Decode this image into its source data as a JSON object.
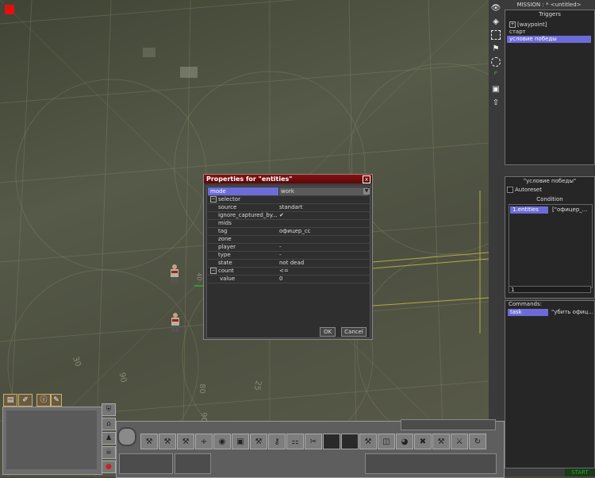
{
  "right_panel": {
    "mission_label": "MISSION : ",
    "mission_name": "* <untitled>",
    "triggers_title": "Triggers",
    "triggers": [
      {
        "label": "[waypoint]",
        "has_expander": true,
        "selected": false
      },
      {
        "label": "старт",
        "has_expander": false,
        "selected": false
      },
      {
        "label": "условие победы",
        "has_expander": false,
        "selected": true
      }
    ],
    "trigger_name": "\"условие победы\"",
    "autoreset_label": "Autoreset",
    "condition_title": "Condition",
    "condition_key": "1.entities",
    "condition_value": "[\"офицер_...",
    "condition_input": "1",
    "commands_title": "Commands:",
    "command_key": "task",
    "command_value": "\"убить офиц...",
    "start_label": "START"
  },
  "dialog": {
    "title": "Properties for \"entities\"",
    "close_symbol": "x",
    "rows": [
      {
        "key": "mode",
        "value": "work",
        "selected": true,
        "dropdown": true
      },
      {
        "key": "selector",
        "value": "",
        "group": true
      },
      {
        "key": "source",
        "value": "standart"
      },
      {
        "key": "ignore_captured_by...",
        "value": "✔"
      },
      {
        "key": "mids",
        "value": ""
      },
      {
        "key": "tag",
        "value": "офицер_сс"
      },
      {
        "key": "zone",
        "value": ""
      },
      {
        "key": "player",
        "value": "-"
      },
      {
        "key": "type",
        "value": "-"
      },
      {
        "key": "state",
        "value": "not dead"
      },
      {
        "key": "count",
        "value": "<=",
        "group": true
      },
      {
        "key": "value",
        "value": "0"
      }
    ],
    "ok_label": "OK",
    "cancel_label": "Cancel"
  },
  "map": {
    "scale_labels": [
      "90",
      "80",
      "25",
      "90",
      "30",
      "40"
    ]
  },
  "colors": {
    "selection": "#6c6cd8",
    "dialog_title": "#8a1010",
    "grid_line": "#c8c040",
    "start": "#2aa02a",
    "marker": "#e01010"
  }
}
